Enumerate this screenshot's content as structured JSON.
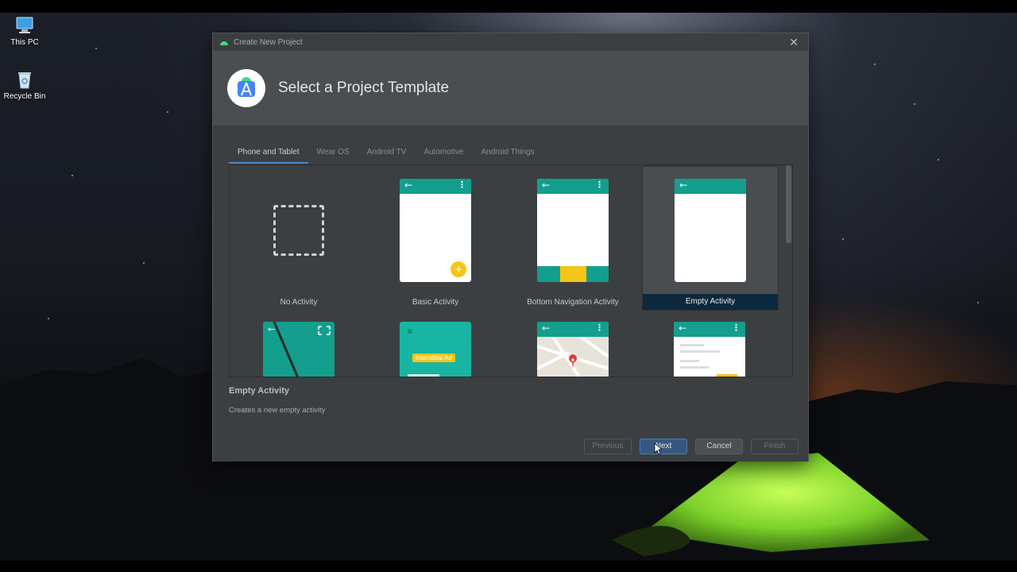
{
  "desktop": {
    "icons": [
      {
        "label": "This PC"
      },
      {
        "label": "Recycle Bin"
      }
    ]
  },
  "dialog": {
    "window_title": "Create New Project",
    "header_title": "Select a Project Template",
    "tabs": [
      {
        "label": "Phone and Tablet",
        "active": true
      },
      {
        "label": "Wear OS"
      },
      {
        "label": "Android TV"
      },
      {
        "label": "Automotive"
      },
      {
        "label": "Android Things"
      }
    ],
    "templates": [
      {
        "label": "No Activity"
      },
      {
        "label": "Basic Activity"
      },
      {
        "label": "Bottom Navigation Activity"
      },
      {
        "label": "Empty Activity",
        "selected": true
      }
    ],
    "row2_badge": "Interstitial Ad",
    "description": {
      "title": "Empty Activity",
      "text": "Creates a new empty activity"
    },
    "buttons": {
      "previous": "Previous",
      "next": "Next",
      "cancel": "Cancel",
      "finish": "Finish"
    },
    "colors": {
      "accent_teal": "#139e8e",
      "accent_yellow": "#f5c518",
      "selected_bg": "#0d293e",
      "primary_button": "#365880"
    }
  }
}
